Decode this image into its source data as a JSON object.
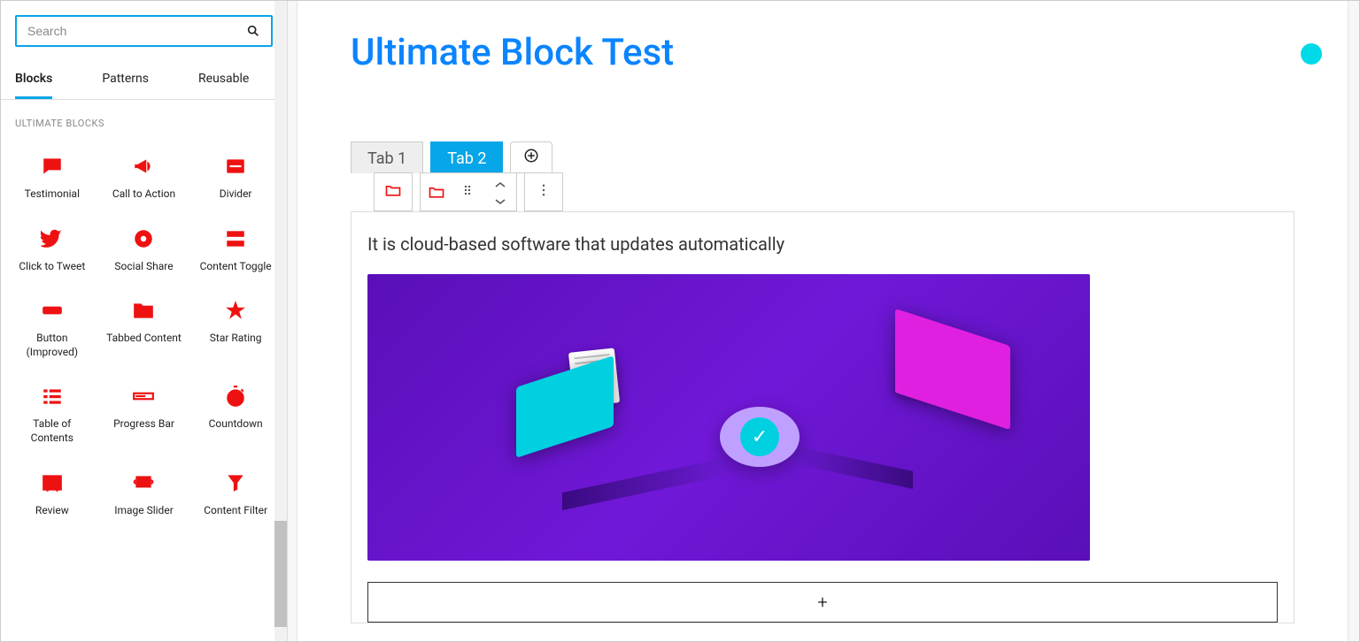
{
  "search": {
    "placeholder": "Search"
  },
  "tabs": [
    {
      "label": "Blocks",
      "active": true
    },
    {
      "label": "Patterns",
      "active": false
    },
    {
      "label": "Reusable",
      "active": false
    }
  ],
  "section_title": "ULTIMATE BLOCKS",
  "blocks": [
    {
      "name": "testimonial",
      "label": "Testimonial",
      "icon": "comment"
    },
    {
      "name": "call-to-action",
      "label": "Call to Action",
      "icon": "megaphone"
    },
    {
      "name": "divider",
      "label": "Divider",
      "icon": "minus"
    },
    {
      "name": "click-to-tweet",
      "label": "Click to Tweet",
      "icon": "twitter"
    },
    {
      "name": "social-share",
      "label": "Social Share",
      "icon": "share"
    },
    {
      "name": "content-toggle",
      "label": "Content Toggle",
      "icon": "rows"
    },
    {
      "name": "button-improved",
      "label": "Button (Improved)",
      "icon": "button"
    },
    {
      "name": "tabbed-content",
      "label": "Tabbed Content",
      "icon": "folder"
    },
    {
      "name": "star-rating",
      "label": "Star Rating",
      "icon": "star"
    },
    {
      "name": "table-of-contents",
      "label": "Table of Contents",
      "icon": "list"
    },
    {
      "name": "progress-bar",
      "label": "Progress Bar",
      "icon": "progress"
    },
    {
      "name": "countdown",
      "label": "Countdown",
      "icon": "stopwatch"
    },
    {
      "name": "review",
      "label": "Review",
      "icon": "review"
    },
    {
      "name": "image-slider",
      "label": "Image Slider",
      "icon": "slider"
    },
    {
      "name": "content-filter",
      "label": "Content Filter",
      "icon": "filter"
    }
  ],
  "page": {
    "title": "Ultimate Block Test"
  },
  "content_tabs": [
    {
      "label": "Tab 1",
      "active": false
    },
    {
      "label": "Tab 2",
      "active": true
    }
  ],
  "content": {
    "text": "It is cloud-based software that updates automatically"
  },
  "add_button": "+",
  "colors": {
    "accent": "#06a6e8",
    "icon": "#e11",
    "title": "#0a84ff",
    "badge": "#00d9e8"
  }
}
